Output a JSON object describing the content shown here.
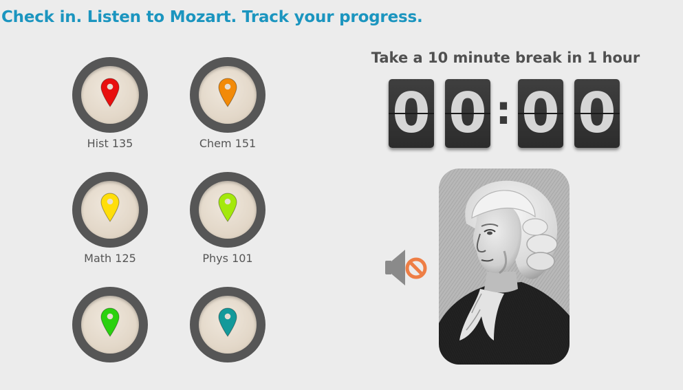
{
  "headline": "Check in. Listen to Mozart. Track your progress.",
  "courses": [
    {
      "label": "Hist 135",
      "pin_color": "#e8100f",
      "pin_icon": "map-pin-icon"
    },
    {
      "label": "Chem 151",
      "pin_color": "#f28a08",
      "pin_icon": "map-pin-icon"
    },
    {
      "label": "Math 125",
      "pin_color": "#ffde0a",
      "pin_icon": "map-pin-icon"
    },
    {
      "label": "Phys 101",
      "pin_color": "#a4e80c",
      "pin_icon": "map-pin-icon"
    },
    {
      "label": "",
      "pin_color": "#2bd10f",
      "pin_icon": "map-pin-icon"
    },
    {
      "label": "",
      "pin_color": "#13999a",
      "pin_icon": "map-pin-icon"
    }
  ],
  "timer": {
    "title": "Take a 10 minute break in 1 hour",
    "digits": [
      "0",
      "0",
      "0",
      "0"
    ],
    "separator": ":"
  },
  "audio": {
    "icon": "speaker-muted-icon",
    "state": "muted"
  },
  "portrait": {
    "icon": "mozart-portrait"
  },
  "colors": {
    "accent": "#1b95bf",
    "background": "#ececec",
    "ring": "#565656",
    "mute_badge": "#ee7e45"
  }
}
